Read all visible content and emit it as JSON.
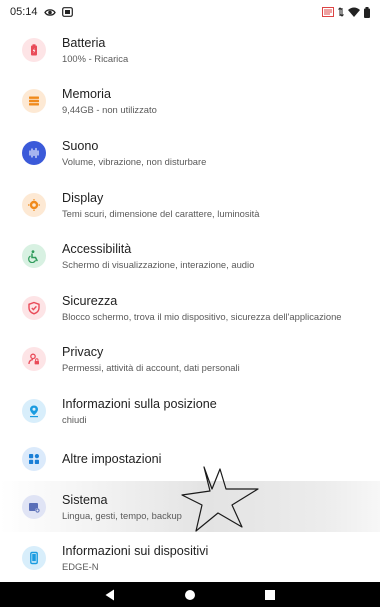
{
  "status_bar": {
    "time": "05:14",
    "left_icons": [
      "eye-icon",
      "screen-record-icon"
    ],
    "right_icons": [
      "nfc-icon",
      "data-arrows-icon",
      "wifi-icon",
      "battery-icon"
    ]
  },
  "settings": {
    "items": [
      {
        "key": "battery",
        "title": "Batteria",
        "subtitle": "100% - Ricarica",
        "icon": "battery-icon",
        "color": "#e94b59",
        "bg": "#fde4e6"
      },
      {
        "key": "storage",
        "title": "Memoria",
        "subtitle": "9,44GB - non utilizzato",
        "icon": "storage-icon",
        "color": "#f08a1c",
        "bg": "#fde9d4"
      },
      {
        "key": "sound",
        "title": "Suono",
        "subtitle": "Volume, vibrazione, non disturbare",
        "icon": "sound-icon",
        "color": "#3b5ad9",
        "bg": "#dfe5fb"
      },
      {
        "key": "display",
        "title": "Display",
        "subtitle": "Temi scuri, dimensione del carattere, luminosità",
        "icon": "display-icon",
        "color": "#f08a1c",
        "bg": "#fde9d4"
      },
      {
        "key": "accessibility",
        "title": "Accessibilità",
        "subtitle": "Schermo di visualizzazione, interazione, audio",
        "icon": "accessibility-icon",
        "color": "#2e9b5a",
        "bg": "#d8f1e2"
      },
      {
        "key": "security",
        "title": "Sicurezza",
        "subtitle": "Blocco schermo, trova il mio dispositivo, sicurezza dell'applicazione",
        "icon": "shield-icon",
        "color": "#e94b59",
        "bg": "#fde4e6"
      },
      {
        "key": "privacy",
        "title": "Privacy",
        "subtitle": "Permessi, attività di account, dati personali",
        "icon": "privacy-icon",
        "color": "#e94b59",
        "bg": "#fde4e6"
      },
      {
        "key": "location",
        "title": "Informazioni sulla posizione",
        "subtitle": "chiudi",
        "icon": "location-icon",
        "color": "#1a9be0",
        "bg": "#d8eefb"
      },
      {
        "key": "more",
        "title": "Altre impostazioni",
        "subtitle": "",
        "icon": "more-settings-icon",
        "color": "#1a7fd6",
        "bg": "#dbeafb"
      },
      {
        "key": "system",
        "title": "Sistema",
        "subtitle": "Lingua, gesti, tempo, backup",
        "icon": "system-icon",
        "color": "#5a6fb8",
        "bg": "#e0e4f5"
      },
      {
        "key": "device",
        "title": "Informazioni sui dispositivi",
        "subtitle": "EDGE-N",
        "icon": "device-icon",
        "color": "#1a9be0",
        "bg": "#d8eefb"
      }
    ]
  },
  "nav_bar": {
    "buttons": [
      "back-icon",
      "home-icon",
      "recents-icon"
    ]
  }
}
